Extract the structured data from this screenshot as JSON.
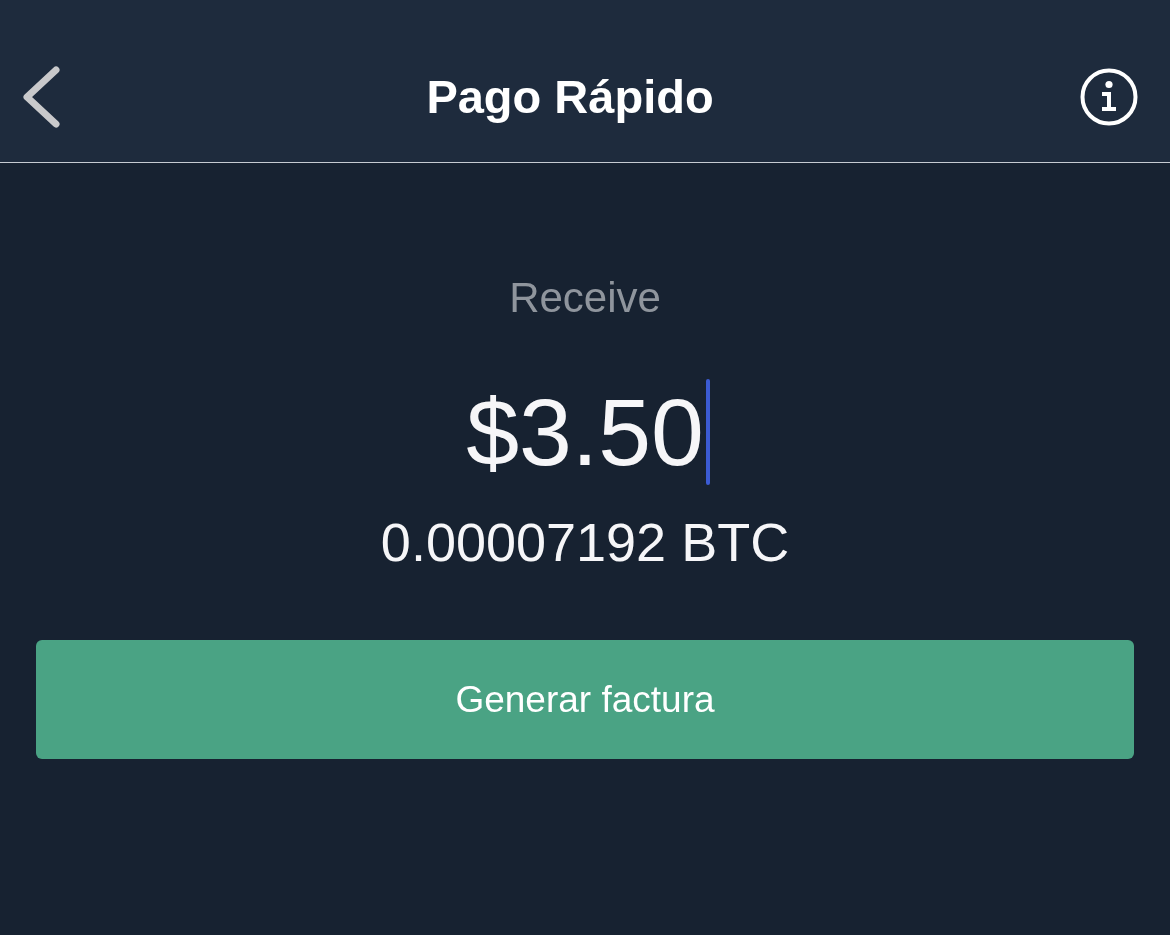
{
  "header": {
    "title": "Pago Rápido"
  },
  "amount_field": {
    "label": "Receive",
    "value": "$3.50",
    "focused": true
  },
  "conversion": "0.00007192 BTC",
  "buttons": [
    {
      "label": "Generar factura"
    }
  ]
}
